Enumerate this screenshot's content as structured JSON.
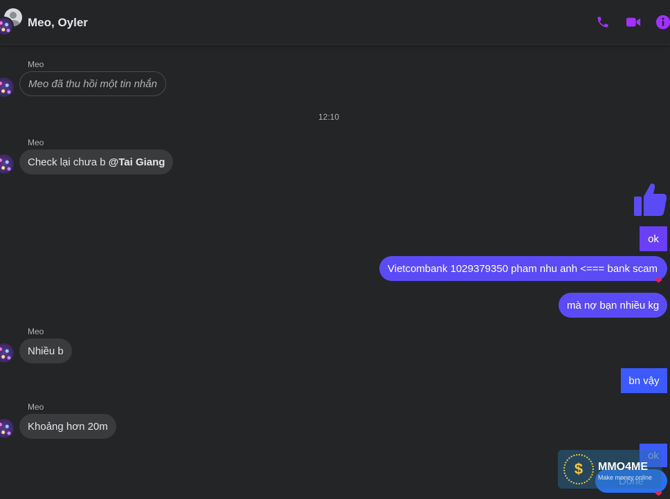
{
  "header": {
    "title": "Meo, Oyler",
    "accent": "#a033ff"
  },
  "messages": {
    "m1_sender": "Meo",
    "m1_text": "Meo đã thu hồi một tin nhắn",
    "timestamp": "12:10",
    "m2_sender": "Meo",
    "m2_text": "Check lại chưa b",
    "m2_mention": "@Tai Giang",
    "out_ok": "ok",
    "out_bank": "Vietcombank 1029379350 pham nhu anh <=== bank scam",
    "out_debt": "mà nợ bạn nhiều kg",
    "m3_sender": "Meo",
    "m3_text": "Nhiều b",
    "out_bn": "bn vậy",
    "m4_sender": "Meo",
    "m4_text": "Khoảng hơn 20m",
    "out_ok2": "ok",
    "out_done": "Done"
  },
  "reactions": {
    "heart": "❤"
  },
  "watermark": {
    "name": "MMO4ME",
    "tagline": "Make money online",
    "logo_glyph": "$"
  }
}
